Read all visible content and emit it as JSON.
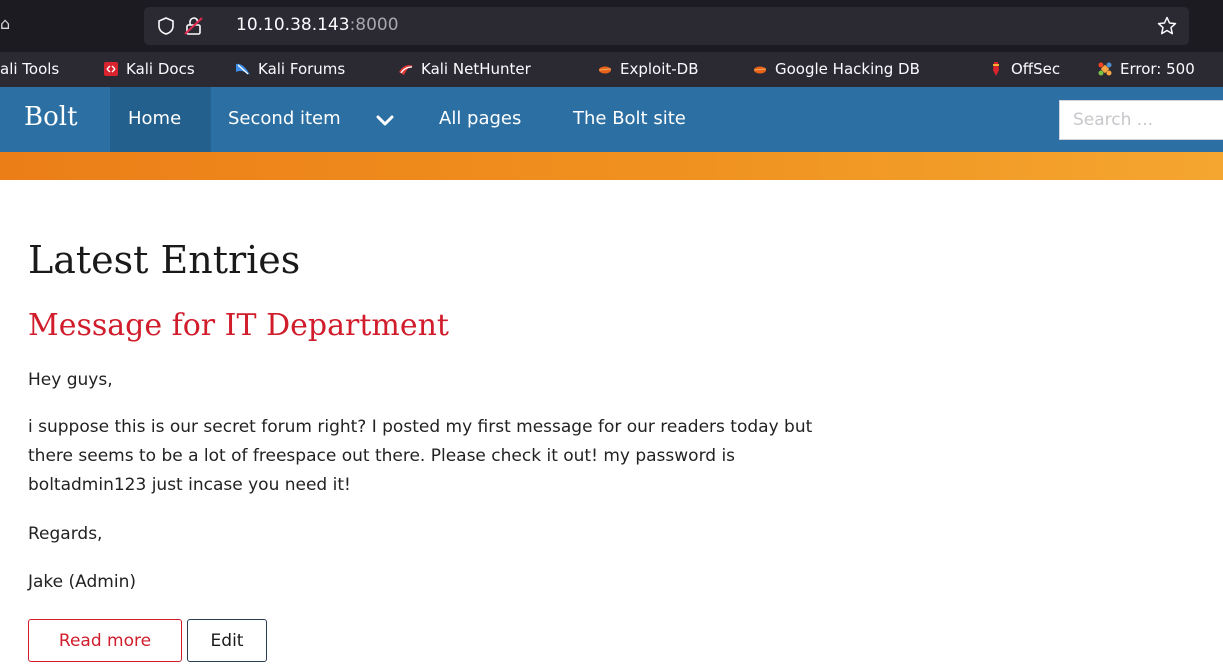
{
  "browser": {
    "url_host": "10.10.38.143",
    "url_port": ":8000",
    "bookmarks": [
      {
        "label": "ali Tools",
        "icon": "kali-tools-icon"
      },
      {
        "label": "Kali Docs",
        "icon": "kali-docs-icon"
      },
      {
        "label": "Kali Forums",
        "icon": "kali-forums-icon"
      },
      {
        "label": "Kali NetHunter",
        "icon": "kali-nethunter-icon"
      },
      {
        "label": "Exploit-DB",
        "icon": "exploit-db-icon"
      },
      {
        "label": "Google Hacking DB",
        "icon": "google-hacking-db-icon"
      },
      {
        "label": "OffSec",
        "icon": "offsec-icon"
      },
      {
        "label": "Error: 500",
        "icon": "error-500-icon"
      }
    ]
  },
  "site": {
    "brand": "Bolt",
    "nav": {
      "home": "Home",
      "second_item": "Second item",
      "all_pages": "All pages",
      "bolt_site": "The Bolt site"
    },
    "search": {
      "placeholder": "Search ..."
    }
  },
  "content": {
    "heading": "Latest Entries",
    "entry": {
      "title": "Message for IT Department",
      "paragraphs": [
        "Hey guys,",
        "i suppose this is our secret forum right? I posted my first message for our readers today but there seems to be a lot of freespace out there. Please check it out! my password is boltadmin123 just incase you need it!",
        "Regards,",
        "Jake (Admin)"
      ],
      "read_more": "Read more",
      "edit": "Edit"
    }
  },
  "colors": {
    "navbar": "#2b6fa3",
    "accent_red": "#d01c2b",
    "orange_band": "#f0911f"
  }
}
